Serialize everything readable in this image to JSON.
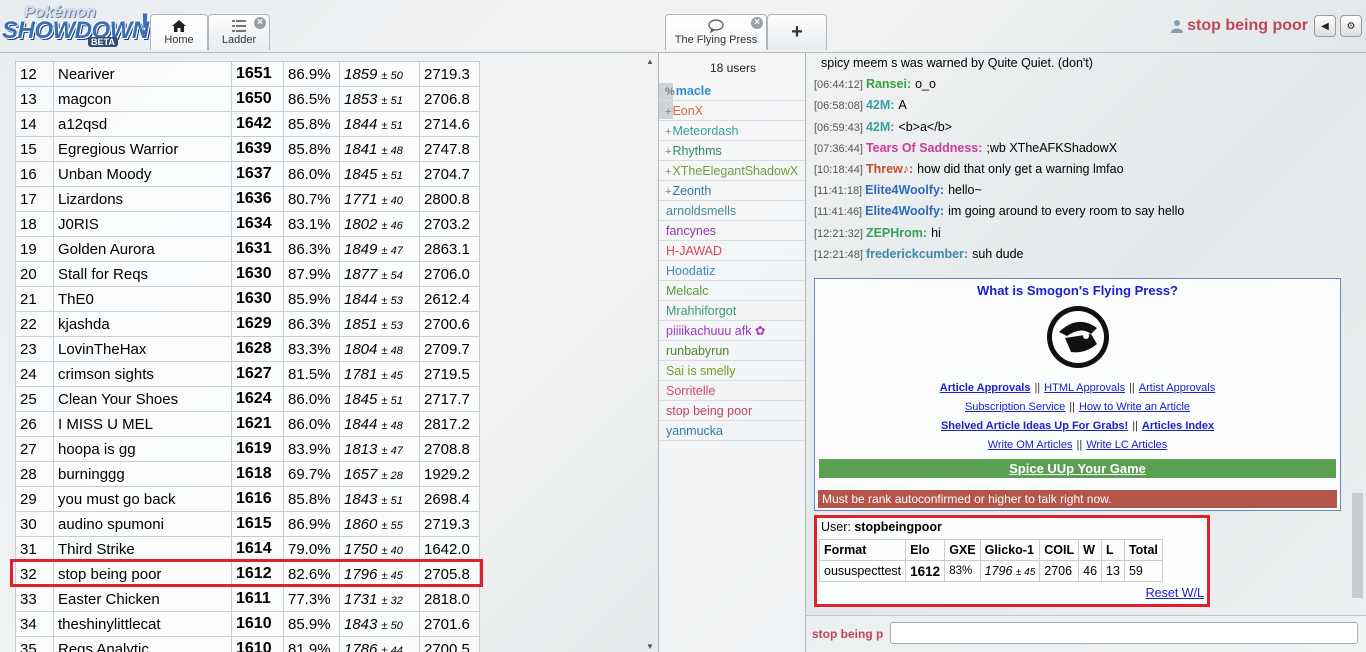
{
  "header": {
    "logo_pokemon": "Pokémon",
    "logo_showdown": "SHOWDOWN",
    "logo_beta": "BETA",
    "tabs": [
      {
        "label": "Home"
      },
      {
        "label": "Ladder"
      },
      {
        "label": "The Flying Press"
      }
    ],
    "new_tab": "+",
    "username": "stop being poor"
  },
  "ladder": {
    "rows": [
      {
        "rank": "12",
        "name": "Neariver",
        "elo": "1651",
        "gxe": "86.9%",
        "glicko": "1859",
        "dev": "± 50",
        "coil": "2719.3"
      },
      {
        "rank": "13",
        "name": "magcon",
        "elo": "1650",
        "gxe": "86.5%",
        "glicko": "1853",
        "dev": "± 51",
        "coil": "2706.8"
      },
      {
        "rank": "14",
        "name": "a12qsd",
        "elo": "1642",
        "gxe": "85.8%",
        "glicko": "1844",
        "dev": "± 51",
        "coil": "2714.6"
      },
      {
        "rank": "15",
        "name": "Egregious Warrior",
        "elo": "1639",
        "gxe": "85.8%",
        "glicko": "1841",
        "dev": "± 48",
        "coil": "2747.8"
      },
      {
        "rank": "16",
        "name": "Unban Moody",
        "elo": "1637",
        "gxe": "86.0%",
        "glicko": "1845",
        "dev": "± 51",
        "coil": "2704.7"
      },
      {
        "rank": "17",
        "name": "Lizardons",
        "elo": "1636",
        "gxe": "80.7%",
        "glicko": "1771",
        "dev": "± 40",
        "coil": "2800.8"
      },
      {
        "rank": "18",
        "name": "J0RIS",
        "elo": "1634",
        "gxe": "83.1%",
        "glicko": "1802",
        "dev": "± 46",
        "coil": "2703.2"
      },
      {
        "rank": "19",
        "name": "Golden Aurora",
        "elo": "1631",
        "gxe": "86.3%",
        "glicko": "1849",
        "dev": "± 47",
        "coil": "2863.1"
      },
      {
        "rank": "20",
        "name": "Stall for Reqs",
        "elo": "1630",
        "gxe": "87.9%",
        "glicko": "1877",
        "dev": "± 54",
        "coil": "2706.0"
      },
      {
        "rank": "21",
        "name": "ThE0",
        "elo": "1630",
        "gxe": "85.9%",
        "glicko": "1844",
        "dev": "± 53",
        "coil": "2612.4"
      },
      {
        "rank": "22",
        "name": "kjashda",
        "elo": "1629",
        "gxe": "86.3%",
        "glicko": "1851",
        "dev": "± 53",
        "coil": "2700.6"
      },
      {
        "rank": "23",
        "name": "LovinTheHax",
        "elo": "1628",
        "gxe": "83.3%",
        "glicko": "1804",
        "dev": "± 48",
        "coil": "2709.7"
      },
      {
        "rank": "24",
        "name": "crimson sights",
        "elo": "1627",
        "gxe": "81.5%",
        "glicko": "1781",
        "dev": "± 45",
        "coil": "2719.5"
      },
      {
        "rank": "25",
        "name": "Clean Your Shoes",
        "elo": "1624",
        "gxe": "86.0%",
        "glicko": "1845",
        "dev": "± 51",
        "coil": "2717.7"
      },
      {
        "rank": "26",
        "name": "I MISS U MEL",
        "elo": "1621",
        "gxe": "86.0%",
        "glicko": "1844",
        "dev": "± 48",
        "coil": "2817.2"
      },
      {
        "rank": "27",
        "name": "hoopa is gg",
        "elo": "1619",
        "gxe": "83.9%",
        "glicko": "1813",
        "dev": "± 47",
        "coil": "2708.8"
      },
      {
        "rank": "28",
        "name": "burninggg",
        "elo": "1618",
        "gxe": "69.7%",
        "glicko": "1657",
        "dev": "± 28",
        "coil": "1929.2"
      },
      {
        "rank": "29",
        "name": "you must go back",
        "elo": "1616",
        "gxe": "85.8%",
        "glicko": "1843",
        "dev": "± 51",
        "coil": "2698.4"
      },
      {
        "rank": "30",
        "name": "audino spumoni",
        "elo": "1615",
        "gxe": "86.9%",
        "glicko": "1860",
        "dev": "± 55",
        "coil": "2719.3"
      },
      {
        "rank": "31",
        "name": "Third Strike",
        "elo": "1614",
        "gxe": "79.0%",
        "glicko": "1750",
        "dev": "± 40",
        "coil": "1642.0"
      },
      {
        "rank": "32",
        "name": "stop being poor",
        "elo": "1612",
        "gxe": "82.6%",
        "glicko": "1796",
        "dev": "± 45",
        "coil": "2705.8"
      },
      {
        "rank": "33",
        "name": "Easter Chicken",
        "elo": "1611",
        "gxe": "77.3%",
        "glicko": "1731",
        "dev": "± 32",
        "coil": "2818.0"
      },
      {
        "rank": "34",
        "name": "theshinylittlecat",
        "elo": "1610",
        "gxe": "85.9%",
        "glicko": "1843",
        "dev": "± 50",
        "coil": "2701.6"
      },
      {
        "rank": "35",
        "name": "Regs Analytic",
        "elo": "1610",
        "gxe": "81.9%",
        "glicko": "1786",
        "dev": "± 44",
        "coil": "2700.5"
      }
    ]
  },
  "userlist": {
    "count": "18 users",
    "users": [
      {
        "group": "%",
        "name": "macle",
        "color": "#2f8fd0",
        "bold": true
      },
      {
        "group": "+",
        "name": "EonX",
        "color": "#e0603a",
        "bold": false
      },
      {
        "group": "+",
        "name": "Meteordash",
        "color": "#3aa0a0",
        "bold": false
      },
      {
        "group": "+",
        "name": "Rhythms",
        "color": "#2f8a6a",
        "bold": false
      },
      {
        "group": "+",
        "name": "XTheElegantShadowX",
        "color": "#6aa040",
        "bold": false
      },
      {
        "group": "+",
        "name": "Zeonth",
        "color": "#2f7ab0",
        "bold": false
      },
      {
        "group": "",
        "name": "arnoldsmells",
        "color": "#4a8a9a",
        "bold": false
      },
      {
        "group": "",
        "name": "fancynes",
        "color": "#8a3aa0",
        "bold": false
      },
      {
        "group": "",
        "name": "H-JAWAD",
        "color": "#d04a5a",
        "bold": false
      },
      {
        "group": "",
        "name": "Hoodatiz",
        "color": "#3a8ac0",
        "bold": false
      },
      {
        "group": "",
        "name": "Melcalc",
        "color": "#5a9a3a",
        "bold": false
      },
      {
        "group": "",
        "name": "Mrahhiforgot",
        "color": "#3a9a7a",
        "bold": false
      },
      {
        "group": "",
        "name": "piiiikachuuu afk ✿",
        "color": "#a03ac0",
        "bold": false
      },
      {
        "group": "",
        "name": "runbabyrun",
        "color": "#4a8a2a",
        "bold": false
      },
      {
        "group": "",
        "name": "Sai is smelly",
        "color": "#7a9a2a",
        "bold": false
      },
      {
        "group": "",
        "name": "Sorritelle",
        "color": "#d04a6a",
        "bold": false
      },
      {
        "group": "",
        "name": "stop being poor",
        "color": "#c0465b",
        "bold": false
      },
      {
        "group": "",
        "name": "yanmucka",
        "color": "#2f7ab0",
        "bold": false
      }
    ]
  },
  "chat": {
    "lines": [
      {
        "ts": "",
        "nick": "",
        "nick_color": "#000",
        "text": "spicy meem s was warned by Quite Quiet. (don't)"
      },
      {
        "ts": "[06:44:12]",
        "nick": "Ransei:",
        "nick_color": "#3aa040",
        "text": "o_o"
      },
      {
        "ts": "[06:58:08]",
        "nick": "42M:",
        "nick_color": "#3aa0a0",
        "text": "A"
      },
      {
        "ts": "[06:59:43]",
        "nick": "42M:",
        "nick_color": "#3aa0a0",
        "text": "<b>a</b>"
      },
      {
        "ts": "[07:36:44]",
        "nick": "Tears Of Saddness:",
        "nick_color": "#d03a9a",
        "text": ";wb XTheAFKShadowX"
      },
      {
        "ts": "[10:18:44]",
        "nick": "Threw♪:",
        "nick_color": "#c0502a",
        "text": "how did that only get a warning lmfao"
      },
      {
        "ts": "[11:41:18]",
        "nick": "Elite4Woolfy:",
        "nick_color": "#2f6ac0",
        "text": "hello~"
      },
      {
        "ts": "[11:41:46]",
        "nick": "Elite4Woolfy:",
        "nick_color": "#2f6ac0",
        "text": "im going around to every room to say hello"
      },
      {
        "ts": "[12:21:32]",
        "nick": "ZEPHrom:",
        "nick_color": "#3aa060",
        "text": "hi"
      },
      {
        "ts": "[12:21:48]",
        "nick": "frederickcumber:",
        "nick_color": "#3a8ab0",
        "text": "suh dude"
      }
    ],
    "infobox": {
      "title": "What is Smogon's Flying Press?",
      "row1": [
        "Article Approvals",
        "HTML Approvals",
        "Artist Approvals"
      ],
      "row2": [
        "Subscription Service",
        "How to Write an Article"
      ],
      "row3": [
        "Shelved Article Ideas Up For Grabs!",
        "Articles Index"
      ],
      "row4": [
        "Write OM Articles",
        "Write LC Articles"
      ],
      "sep": "||",
      "green_link": "Spice UUp Your Game",
      "warning": "Must be rank autoconfirmed or higher to talk right now.",
      "colors": {
        "green": "#5a9f52",
        "warning": "#b4554a",
        "link": "#1a22c8"
      }
    },
    "user_card": {
      "label": "User:",
      "user": "stopbeingpoor",
      "headers": [
        "Format",
        "Elo",
        "GXE",
        "Glicko-1",
        "COIL",
        "W",
        "L",
        "Total"
      ],
      "row": {
        "format": "oususpecttest",
        "elo": "1612",
        "gxe": "83%",
        "glicko": "1796",
        "dev": "± 45",
        "coil": "2706",
        "w": "46",
        "l": "13",
        "total": "59"
      },
      "reset": "Reset W/L"
    },
    "input_name": "stop being p",
    "input_value": ""
  },
  "icons": {
    "home": "home-icon",
    "ladder": "list-icon",
    "room": "chat-bubble-icon",
    "user": "user-icon",
    "sound": "volume-icon",
    "options": "gear-icon"
  },
  "highlight_color": "#e0202a"
}
